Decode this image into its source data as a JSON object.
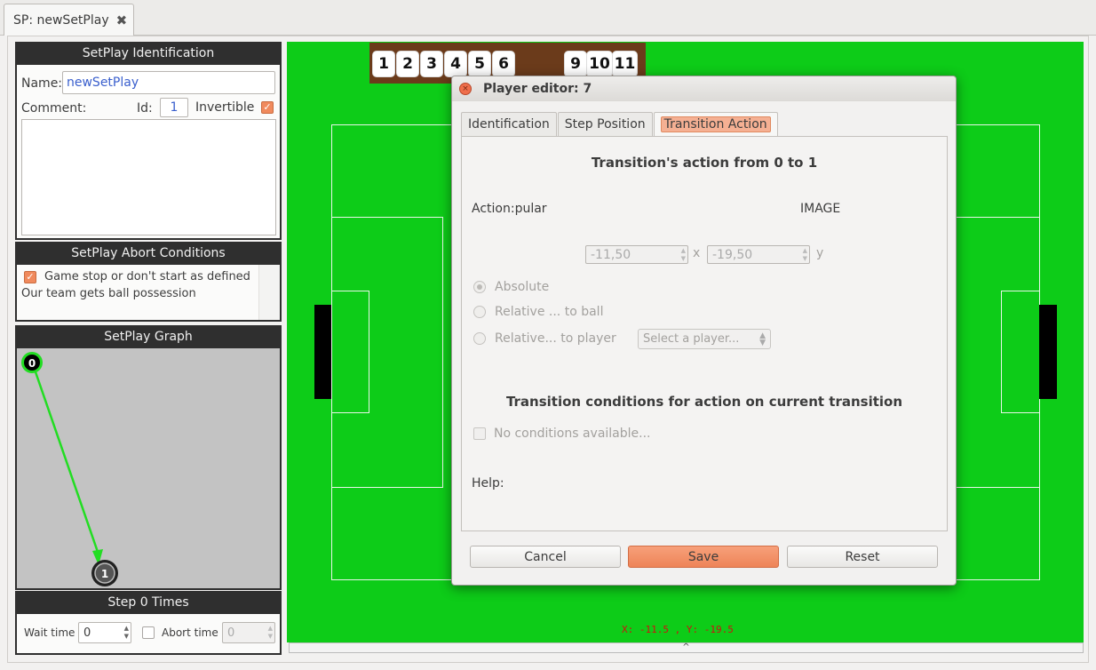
{
  "tab": {
    "title": "SP: newSetPlay",
    "close_glyph": "✖"
  },
  "identification": {
    "header": "SetPlay Identification",
    "name_label": "Name:",
    "name_value": "newSetPlay",
    "comment_label": "Comment:",
    "id_label": "Id:",
    "id_value": "1",
    "invertible_label": "Invertible",
    "invertible_checked": true
  },
  "abort": {
    "header": "SetPlay Abort Conditions",
    "items": [
      {
        "label": "Game stop or don't start as defined",
        "checked": true
      },
      {
        "label": "Our team gets ball possession"
      }
    ]
  },
  "graph": {
    "header": "SetPlay Graph",
    "nodes": [
      {
        "label": "0"
      },
      {
        "label": "1"
      }
    ]
  },
  "step": {
    "header": "Step 0 Times",
    "wait_label": "Wait time",
    "wait_value": "0",
    "abort_label": "Abort time",
    "abort_value": "0"
  },
  "field": {
    "players": [
      "1",
      "2",
      "3",
      "4",
      "5",
      "6",
      "9",
      "10",
      "11"
    ],
    "coords": "X: -11.5 , Y: -19.5",
    "collapse_glyph": "^"
  },
  "dialog": {
    "title": "Player editor: 7",
    "close_glyph": "×",
    "tabs": [
      {
        "label": "Identification",
        "active": false
      },
      {
        "label": "Step Position",
        "active": false
      },
      {
        "label": "Transition Action",
        "active": true
      }
    ],
    "heading": "Transition's action from 0 to 1",
    "action_label": "Action:pular",
    "image_label": "IMAGE",
    "x_value": "-11,50",
    "x_label": "x",
    "y_value": "-19,50",
    "y_label": "y",
    "radios": [
      {
        "label": "Absolute",
        "selected": true
      },
      {
        "label": "Relative ... to ball",
        "selected": false
      },
      {
        "label": "Relative... to player",
        "selected": false
      }
    ],
    "player_select": "Select a player...",
    "conditions_heading": "Transition conditions for action on current transition",
    "no_conditions": "No conditions available...",
    "help_label": "Help:",
    "buttons": {
      "cancel": "Cancel",
      "save": "Save",
      "reset": "Reset"
    }
  },
  "colors": {
    "field": "#0dcc18",
    "bench": "#6b3b1b",
    "accent": "#f08a5d",
    "graph_edge": "#22dd22",
    "section_header": "#2f2f2f"
  }
}
